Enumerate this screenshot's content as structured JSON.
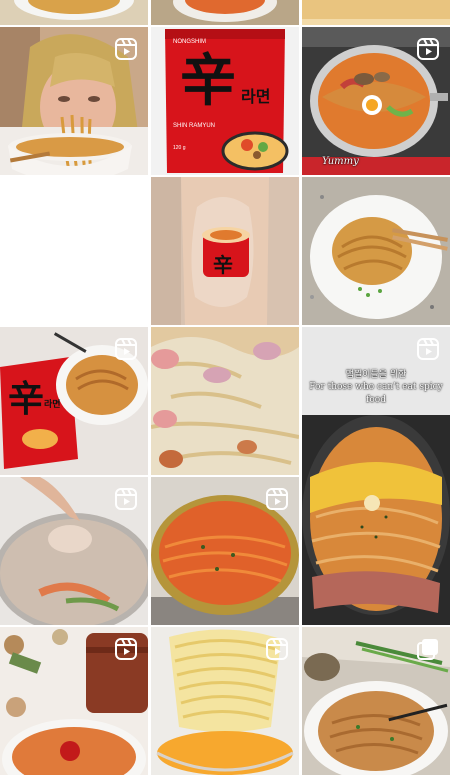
{
  "grid": {
    "tiles": [
      {
        "id": "row0-col0",
        "type": "video"
      },
      {
        "id": "row0-col1",
        "type": "video"
      },
      {
        "id": "row0-col2",
        "type": "video"
      },
      {
        "id": "row1-col0",
        "type": "reel",
        "subject": "woman eating noodles"
      },
      {
        "id": "row1-col1",
        "type": "reel",
        "subject": "Shin Ramyun package"
      },
      {
        "id": "row1-col2",
        "type": "reel",
        "subject": "ramen pot with egg"
      },
      {
        "id": "row2-col0",
        "type": "video",
        "subject": "arm with ramen cup sticker"
      },
      {
        "id": "row2-col1",
        "type": "video",
        "subject": "noodles with chopsticks"
      },
      {
        "id": "row3-col0",
        "type": "reel",
        "subject": "ramen bag and bowl"
      },
      {
        "id": "row3-col1",
        "type": "video",
        "subject": "sausage ramen"
      },
      {
        "id": "row3-col2",
        "type": "reel",
        "subject": "cheese ramen pot"
      },
      {
        "id": "row4-col0",
        "type": "reel",
        "subject": "pot lid cooking"
      },
      {
        "id": "row4-col1",
        "type": "reel",
        "subject": "ramen in gold pot"
      },
      {
        "id": "row5-col0",
        "type": "reel",
        "subject": "korean table ramen"
      },
      {
        "id": "row5-col1",
        "type": "reel",
        "subject": "lifting noodles"
      },
      {
        "id": "row5-col2",
        "type": "carousel",
        "subject": "ramen with scallions"
      }
    ],
    "package": {
      "brand": "NONGSHIM",
      "hanja": "辛",
      "hangul": "라면",
      "name": "SHIN RAMYUN",
      "weight": "120 g"
    },
    "cup_sticker": {
      "hanja": "辛"
    },
    "small_bag": {
      "hanja": "辛",
      "hangul": "라면"
    },
    "watermark": "Yummy",
    "caption": {
      "korean": "맵찔이들을 위한",
      "english": "For those who can't eat spicy food"
    }
  },
  "colors": {
    "background": "#ffffff",
    "gap": "#ffffff",
    "badge": "#ffffff",
    "package_red": "#d7141b"
  }
}
